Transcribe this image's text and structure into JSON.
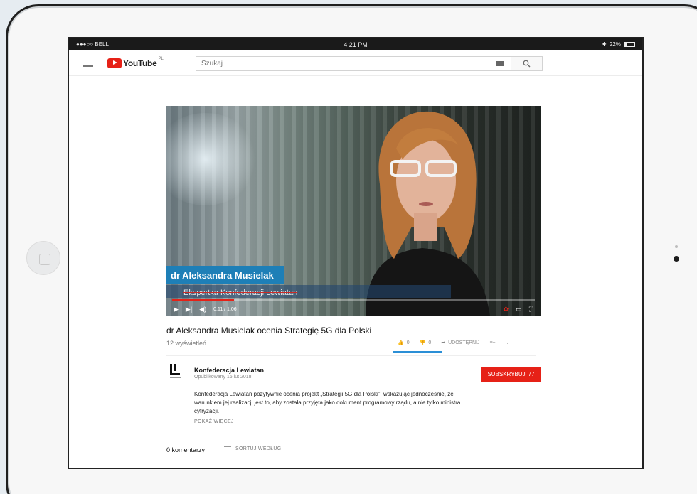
{
  "statusbar": {
    "carrier": "●●●○○ BELL",
    "time": "4:21 PM",
    "battery": "22%"
  },
  "header": {
    "logo_text": "YouTube",
    "region": "PL",
    "search_placeholder": "Szukaj"
  },
  "video": {
    "lower_third_name": "dr Aleksandra Musielak",
    "lower_third_role": "Ekspertka Konfederacji Lewiatan",
    "time": "0:11 / 1:06",
    "progress": 0.17
  },
  "info": {
    "title": "dr Aleksandra Musielak ocenia Strategię 5G dla Polski",
    "views": "12 wyświetleń",
    "likes": "0",
    "dislikes": "0",
    "share_label": "UDOSTĘPNIJ",
    "more_icon": "..."
  },
  "channel": {
    "name": "Konfederacja Lewiatan",
    "published": "Opublikowany 16 lut 2018",
    "subscribe_label": "SUBSKRYBUJ",
    "subscriber_count": "77",
    "description": "Konfederacja Lewiatan pozytywnie ocenia projekt „Strategii 5G dla Polski”, wskazując jednocześnie, że warunkiem jej realizacji jest to, aby została przyjęta jako dokument programowy rządu, a nie tylko ministra cyfryzacji.",
    "show_more": "POKAŻ WIĘCEJ"
  },
  "comments": {
    "count_label": "0 komentarzy",
    "sort_label": "SORTUJ WEDŁUG"
  },
  "colors": {
    "brand_red": "#e62117",
    "lower_third_blue": "#1e7fb7",
    "accent_blue": "#2b8fd6"
  }
}
